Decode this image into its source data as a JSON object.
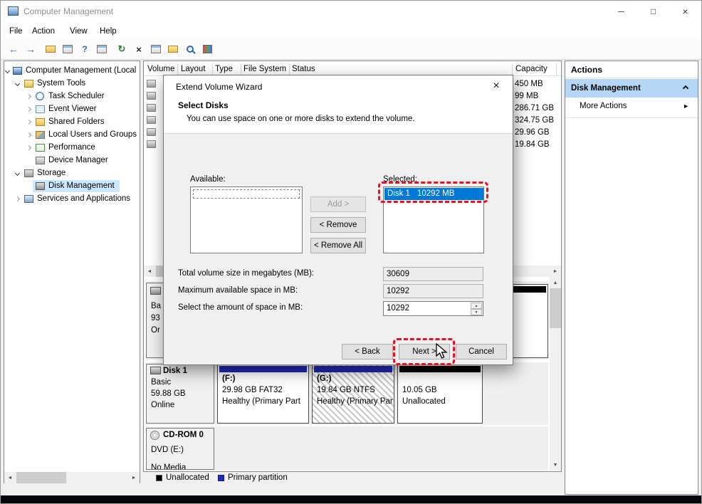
{
  "window": {
    "title": "Computer Management"
  },
  "glyphs": {
    "minimize": "─",
    "maximize": "□",
    "close": "×",
    "back": "←",
    "forward": "→",
    "help": "?",
    "refresh": "↻",
    "delete": "×",
    "up": "▲",
    "down": "▼",
    "left": "◄",
    "right": "►"
  },
  "menu": {
    "items": [
      "File",
      "Action",
      "View",
      "Help"
    ]
  },
  "toolbar": {
    "icon_names": [
      "back-icon",
      "forward-icon",
      "up-level-icon",
      "console-tree-icon",
      "help-icon",
      "action-pane-icon",
      "refresh-icon",
      "delete-icon",
      "properties-icon",
      "open-folder-icon",
      "find-icon",
      "blocks-icon"
    ]
  },
  "tree": {
    "items": [
      {
        "label": "Computer Management (Local"
      },
      {
        "label": "System Tools"
      },
      {
        "label": "Task Scheduler"
      },
      {
        "label": "Event Viewer"
      },
      {
        "label": "Shared Folders"
      },
      {
        "label": "Local Users and Groups"
      },
      {
        "label": "Performance"
      },
      {
        "label": "Device Manager"
      },
      {
        "label": "Storage"
      },
      {
        "label": "Disk Management"
      },
      {
        "label": "Services and Applications"
      }
    ]
  },
  "volume_list": {
    "columns": [
      "Volume",
      "Layout",
      "Type",
      "File System",
      "Status",
      "Capacity"
    ],
    "capacities": [
      "450 MB",
      "99 MB",
      "286.71 GB",
      "324.75 GB",
      "29.96 GB",
      "19.84 GB"
    ]
  },
  "actions": {
    "title": "Actions",
    "selected_item": "Disk Management",
    "more_actions": "More Actions"
  },
  "wizard": {
    "title": "Extend Volume Wizard",
    "heading": "Select Disks",
    "description": "You can use space on one or more disks to extend the volume.",
    "available_label": "Available:",
    "selected_label": "Selected:",
    "add_button": "Add >",
    "remove_button": "< Remove",
    "remove_all_button": "< Remove All",
    "selected_item": {
      "name": "Disk 1",
      "size": "10292 MB"
    },
    "total_label": "Total volume size in megabytes (MB):",
    "total_value": "30609",
    "max_label": "Maximum available space in MB:",
    "max_value": "10292",
    "amount_label": "Select the amount of space in MB:",
    "amount_value": "10292",
    "back_button": "< Back",
    "next_button": "Next >",
    "cancel_button": "Cancel"
  },
  "graphical": {
    "disk0_fragments": {
      "line1": "Ba",
      "line2": "93",
      "line3": "Or"
    },
    "disk1": {
      "name": "Disk 1",
      "type": "Basic",
      "size": "59.88 GB",
      "status": "Online"
    },
    "partition_f": {
      "name": "(F:)",
      "detail": "29.98 GB FAT32",
      "status": "Healthy (Primary Part"
    },
    "partition_g": {
      "name": "(G:)",
      "detail": "19.84 GB NTFS",
      "status": "Healthy (Primary Par"
    },
    "unallocated": {
      "size": "10.05 GB",
      "label": "Unallocated"
    },
    "cdrom": {
      "name": "CD-ROM 0",
      "drive": "DVD (E:)",
      "media": "No Media"
    }
  },
  "legend": {
    "unallocated": "Unallocated",
    "primary": "Primary partition"
  },
  "colors": {
    "selection_blue": "#0078d7",
    "annotation_red": "#e81123",
    "primary_partition_blue": "#2228b8",
    "unallocated_black": "#000000",
    "actions_highlight": "#b5d7f5",
    "tree_highlight": "#cce8ff"
  }
}
